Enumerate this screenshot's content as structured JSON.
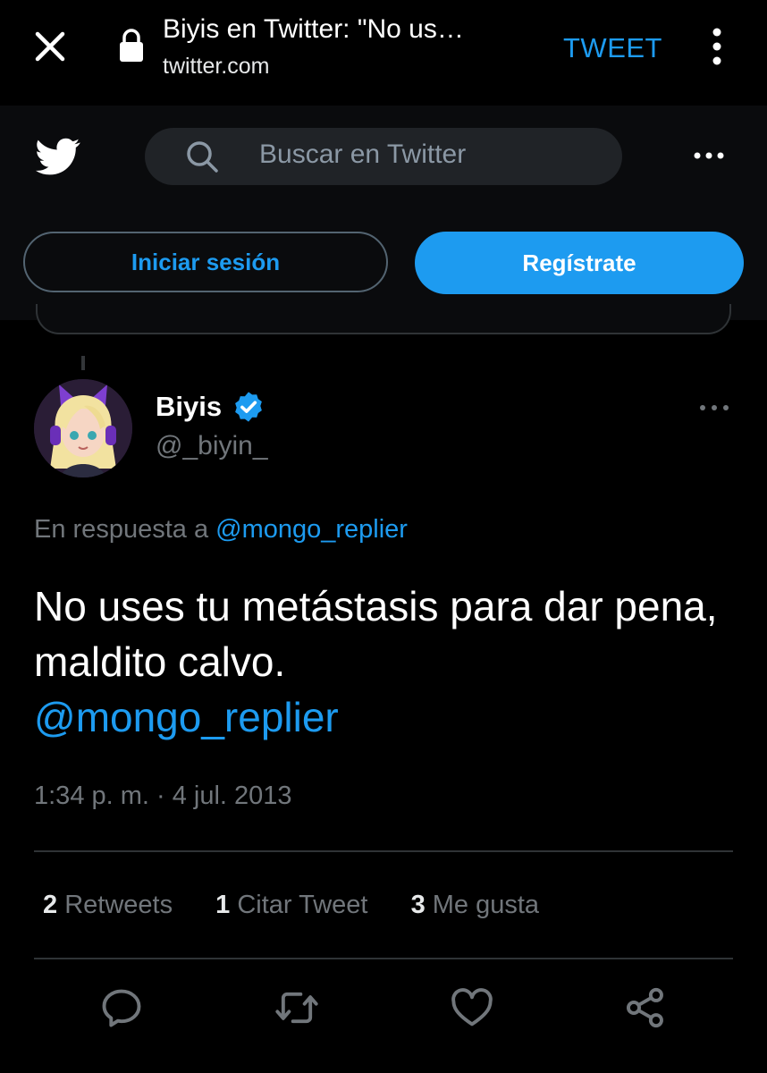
{
  "browser": {
    "title": "Biyis en Twitter: \"No us…",
    "domain": "twitter.com",
    "action_label": "TWEET"
  },
  "header": {
    "search_placeholder": "Buscar en Twitter",
    "login_label": "Iniciar sesión",
    "signup_label": "Regístrate"
  },
  "tweet": {
    "display_name": "Biyis",
    "handle": "@_biyin_",
    "reply_prefix": "En respuesta a ",
    "reply_mention": "@mongo_replier",
    "text": "No uses tu metástasis para dar pena, maldito calvo.",
    "text_mention": "@mongo_replier",
    "timestamp": "1:34 p. m. · 4 jul. 2013",
    "stats": [
      {
        "count": "2",
        "label": " Retweets"
      },
      {
        "count": "1",
        "label": " Citar Tweet"
      },
      {
        "count": "3",
        "label": " Me gusta"
      }
    ]
  },
  "icons": [
    "close-icon",
    "lock-icon",
    "overflow-menu-icon",
    "twitter-bird-icon",
    "search-icon",
    "more-icon",
    "verified-badge-icon",
    "reply-icon",
    "retweet-icon",
    "like-icon",
    "share-icon"
  ],
  "colors": {
    "accent": "#1d9bf0",
    "background": "#000000",
    "muted_text": "#71767b",
    "search_bg": "#202327"
  }
}
